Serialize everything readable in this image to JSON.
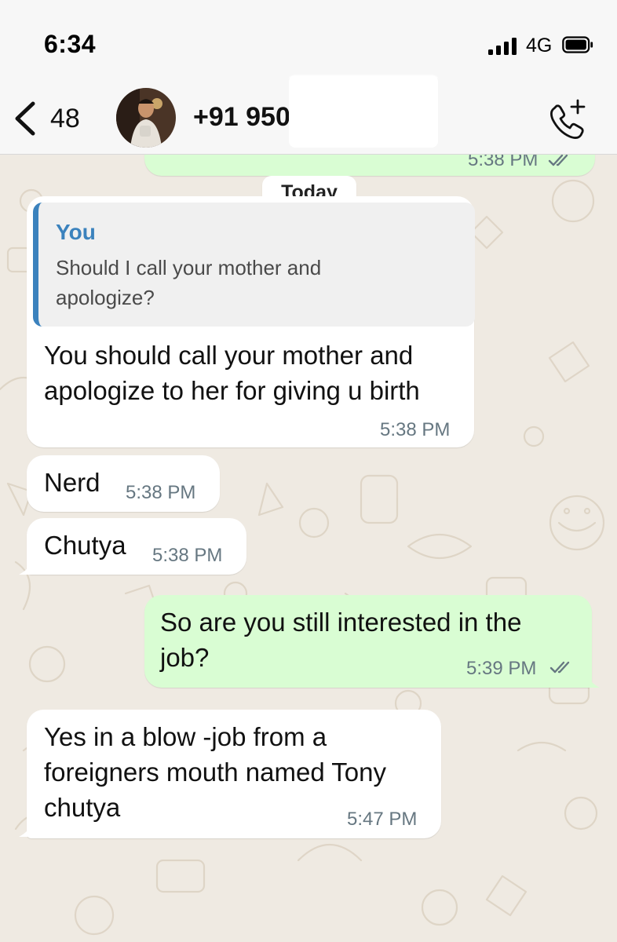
{
  "status_bar": {
    "time": "6:34",
    "network": "4G"
  },
  "header": {
    "back_count": "48",
    "contact_name": "+91 950",
    "avatar_icon": "contact-avatar",
    "call_icon": "phone-add-call-icon"
  },
  "previous_message": {
    "time": "5:38 PM"
  },
  "date_chip": "Today",
  "messages": [
    {
      "direction": "incoming",
      "reply_to": {
        "author": "You",
        "text": "Should I call your mother and\napologize?"
      },
      "text": "You should call your mother and\napologize to her for giving u birth",
      "time": "5:38 PM"
    },
    {
      "direction": "incoming",
      "text": "Nerd",
      "time": "5:38 PM"
    },
    {
      "direction": "incoming",
      "text": "Chutya",
      "time": "5:38 PM"
    },
    {
      "direction": "outgoing",
      "text": "So are you still interested in the\njob?",
      "time": "5:39 PM",
      "status": "read"
    },
    {
      "direction": "incoming",
      "text": "Yes in a blow -job from a\nforeigners mouth named Tony\nchutya",
      "time": "5:47 PM"
    }
  ],
  "colors": {
    "chat_background": "#efeae2",
    "incoming_bubble": "#ffffff",
    "outgoing_bubble": "#d9fdd3",
    "quote_accent": "#3b82bd",
    "timestamp": "#667781"
  }
}
